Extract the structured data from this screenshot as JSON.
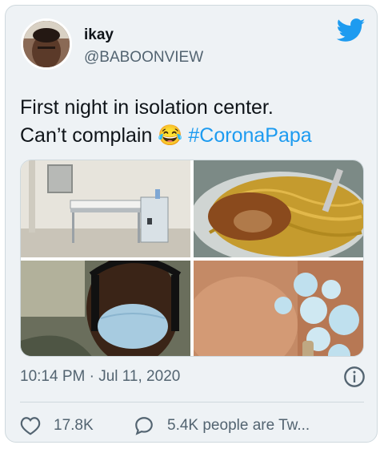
{
  "tweet": {
    "author_name": "ikay",
    "author_handle": "@BABOONVIEW",
    "text_line1": "First night in isolation center.",
    "text_line2": "Can’t complain ",
    "emoji": "😂",
    "hashtag": "#CoronaPapa",
    "timestamp": "10:14 PM · Jul 11, 2020",
    "likes": "17.8K",
    "replies": "5.4K people are Tw..."
  },
  "icons": {
    "brand": "twitter-bird-icon",
    "info": "info-icon",
    "like": "heart-icon",
    "reply": "comment-icon"
  },
  "colors": {
    "accent": "#1d9bf0",
    "text": "#0f1419",
    "muted": "#536471",
    "card_bg": "#eef2f5"
  }
}
